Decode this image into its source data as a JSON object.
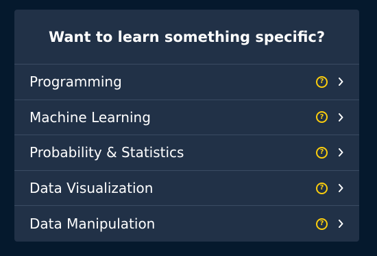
{
  "card": {
    "title": "Want to learn something specific?"
  },
  "topics": [
    {
      "label": "Programming",
      "help_icon": "help-circle-icon",
      "chevron": "chevron-right-icon"
    },
    {
      "label": "Machine Learning",
      "help_icon": "help-circle-icon",
      "chevron": "chevron-right-icon"
    },
    {
      "label": "Probability & Statistics",
      "help_icon": "help-circle-icon",
      "chevron": "chevron-right-icon"
    },
    {
      "label": "Data Visualization",
      "help_icon": "help-circle-icon",
      "chevron": "chevron-right-icon"
    },
    {
      "label": "Data Manipulation",
      "help_icon": "help-circle-icon",
      "chevron": "chevron-right-icon"
    }
  ],
  "help_glyph": "?",
  "colors": {
    "background": "#05192d",
    "card": "#213147",
    "divider": "#3a4b63",
    "help_icon": "#fcce0d",
    "text": "#ffffff"
  }
}
